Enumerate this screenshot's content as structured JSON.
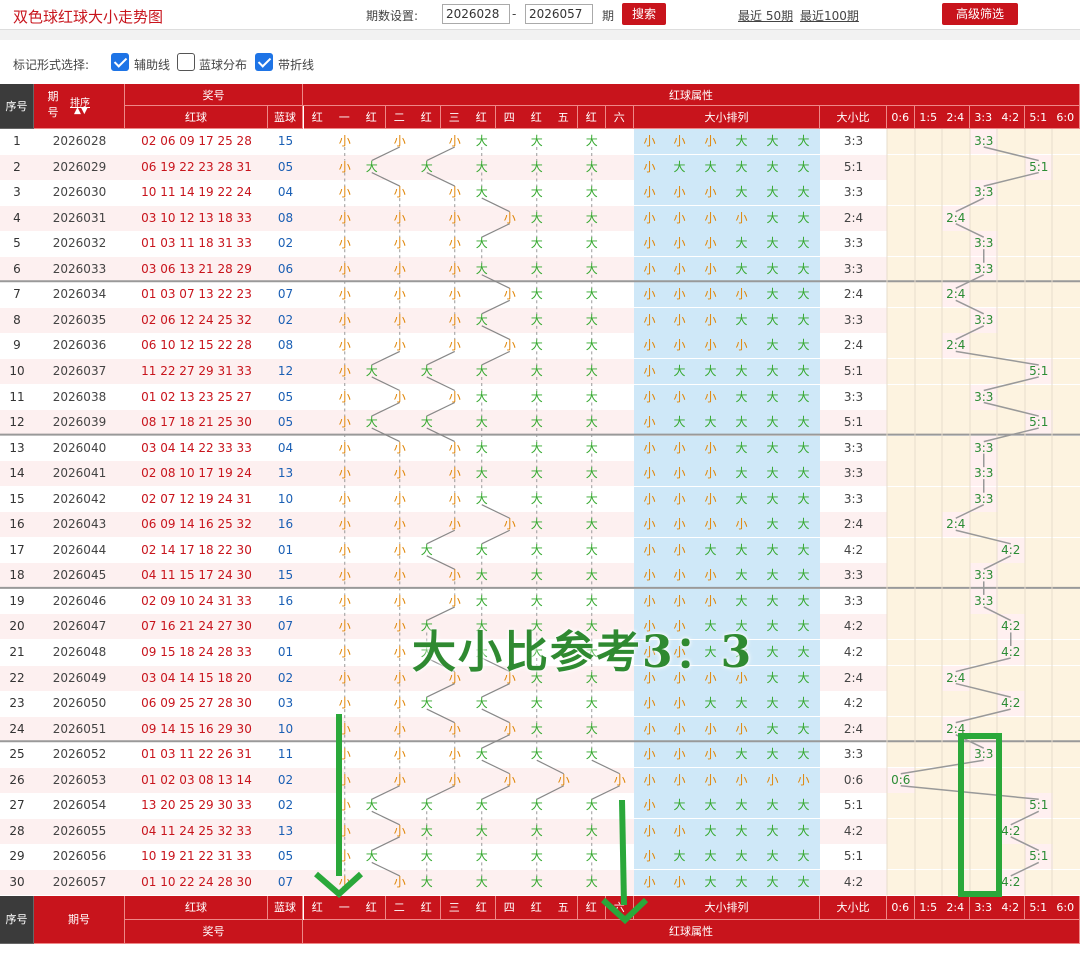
{
  "topbar": {
    "title": "双色球红球大小走势图",
    "period_label": "期数设置:",
    "from_value": "2026028",
    "dash": "-",
    "to_value": "2026057",
    "period_unit": "期",
    "search_label": "搜索",
    "recent50": "最近 50期",
    "recent100": "最近100期",
    "advanced_label": "高级筛选"
  },
  "options": {
    "label": "标记形式选择:",
    "aux_line": {
      "label": "辅助线",
      "checked": true
    },
    "blue_dist": {
      "label": "蓝球分布",
      "checked": false
    },
    "fold_line": {
      "label": "带折线",
      "checked": true
    }
  },
  "header": {
    "seq": "序号",
    "period": "期号",
    "sort": "排序",
    "prize": "奖号",
    "red_ball": "红球",
    "blue_ball": "蓝球",
    "red_attr": "红球属性",
    "size_arrange": "大小排列",
    "size_ratio": "大小比",
    "pos_labels": [
      "红",
      "一",
      "红",
      "二",
      "红",
      "三",
      "红",
      "四",
      "红",
      "五",
      "红",
      "六"
    ],
    "ratio_cols": [
      "0:6",
      "1:5",
      "2:4",
      "3:3",
      "4:2",
      "5:1",
      "6:0"
    ]
  },
  "rows": [
    {
      "seq": "1",
      "period": "2026028",
      "red": "02 06 09 17 25 28",
      "blue": "15",
      "sizes": [
        "小",
        "小",
        "小",
        "大",
        "大",
        "大"
      ],
      "ratio": "3:3"
    },
    {
      "seq": "2",
      "period": "2026029",
      "red": "06 19 22 23 28 31",
      "blue": "05",
      "sizes": [
        "小",
        "大",
        "大",
        "大",
        "大",
        "大"
      ],
      "ratio": "5:1"
    },
    {
      "seq": "3",
      "period": "2026030",
      "red": "10 11 14 19 22 24",
      "blue": "04",
      "sizes": [
        "小",
        "小",
        "小",
        "大",
        "大",
        "大"
      ],
      "ratio": "3:3"
    },
    {
      "seq": "4",
      "period": "2026031",
      "red": "03 10 12 13 18 33",
      "blue": "08",
      "sizes": [
        "小",
        "小",
        "小",
        "小",
        "大",
        "大"
      ],
      "ratio": "2:4"
    },
    {
      "seq": "5",
      "period": "2026032",
      "red": "01 03 11 18 31 33",
      "blue": "02",
      "sizes": [
        "小",
        "小",
        "小",
        "大",
        "大",
        "大"
      ],
      "ratio": "3:3"
    },
    {
      "seq": "6",
      "period": "2026033",
      "red": "03 06 13 21 28 29",
      "blue": "06",
      "sizes": [
        "小",
        "小",
        "小",
        "大",
        "大",
        "大"
      ],
      "ratio": "3:3"
    },
    {
      "seq": "7",
      "period": "2026034",
      "red": "01 03 07 13 22 23",
      "blue": "07",
      "sizes": [
        "小",
        "小",
        "小",
        "小",
        "大",
        "大"
      ],
      "ratio": "2:4"
    },
    {
      "seq": "8",
      "period": "2026035",
      "red": "02 06 12 24 25 32",
      "blue": "02",
      "sizes": [
        "小",
        "小",
        "小",
        "大",
        "大",
        "大"
      ],
      "ratio": "3:3"
    },
    {
      "seq": "9",
      "period": "2026036",
      "red": "06 10 12 15 22 28",
      "blue": "08",
      "sizes": [
        "小",
        "小",
        "小",
        "小",
        "大",
        "大"
      ],
      "ratio": "2:4"
    },
    {
      "seq": "10",
      "period": "2026037",
      "red": "11 22 27 29 31 33",
      "blue": "12",
      "sizes": [
        "小",
        "大",
        "大",
        "大",
        "大",
        "大"
      ],
      "ratio": "5:1"
    },
    {
      "seq": "11",
      "period": "2026038",
      "red": "01 02 13 23 25 27",
      "blue": "05",
      "sizes": [
        "小",
        "小",
        "小",
        "大",
        "大",
        "大"
      ],
      "ratio": "3:3"
    },
    {
      "seq": "12",
      "period": "2026039",
      "red": "08 17 18 21 25 30",
      "blue": "05",
      "sizes": [
        "小",
        "大",
        "大",
        "大",
        "大",
        "大"
      ],
      "ratio": "5:1"
    },
    {
      "seq": "13",
      "period": "2026040",
      "red": "03 04 14 22 33 33",
      "blue": "04",
      "sizes": [
        "小",
        "小",
        "小",
        "大",
        "大",
        "大"
      ],
      "ratio": "3:3"
    },
    {
      "seq": "14",
      "period": "2026041",
      "red": "02 08 10 17 19 24",
      "blue": "13",
      "sizes": [
        "小",
        "小",
        "小",
        "大",
        "大",
        "大"
      ],
      "ratio": "3:3"
    },
    {
      "seq": "15",
      "period": "2026042",
      "red": "02 07 12 19 24 31",
      "blue": "10",
      "sizes": [
        "小",
        "小",
        "小",
        "大",
        "大",
        "大"
      ],
      "ratio": "3:3"
    },
    {
      "seq": "16",
      "period": "2026043",
      "red": "06 09 14 16 25 32",
      "blue": "16",
      "sizes": [
        "小",
        "小",
        "小",
        "小",
        "大",
        "大"
      ],
      "ratio": "2:4"
    },
    {
      "seq": "17",
      "period": "2026044",
      "red": "02 14 17 18 22 30",
      "blue": "01",
      "sizes": [
        "小",
        "小",
        "大",
        "大",
        "大",
        "大"
      ],
      "ratio": "4:2"
    },
    {
      "seq": "18",
      "period": "2026045",
      "red": "04 11 15 17 24 30",
      "blue": "15",
      "sizes": [
        "小",
        "小",
        "小",
        "大",
        "大",
        "大"
      ],
      "ratio": "3:3"
    },
    {
      "seq": "19",
      "period": "2026046",
      "red": "02 09 10 24 31 33",
      "blue": "16",
      "sizes": [
        "小",
        "小",
        "小",
        "大",
        "大",
        "大"
      ],
      "ratio": "3:3"
    },
    {
      "seq": "20",
      "period": "2026047",
      "red": "07 16 21 24 27 30",
      "blue": "07",
      "sizes": [
        "小",
        "小",
        "大",
        "大",
        "大",
        "大"
      ],
      "ratio": "4:2"
    },
    {
      "seq": "21",
      "period": "2026048",
      "red": "09 15 18 24 28 33",
      "blue": "01",
      "sizes": [
        "小",
        "小",
        "大",
        "大",
        "大",
        "大"
      ],
      "ratio": "4:2"
    },
    {
      "seq": "22",
      "period": "2026049",
      "red": "03 04 14 15 18 20",
      "blue": "02",
      "sizes": [
        "小",
        "小",
        "小",
        "小",
        "大",
        "大"
      ],
      "ratio": "2:4"
    },
    {
      "seq": "23",
      "period": "2026050",
      "red": "06 09 25 27 28 30",
      "blue": "03",
      "sizes": [
        "小",
        "小",
        "大",
        "大",
        "大",
        "大"
      ],
      "ratio": "4:2"
    },
    {
      "seq": "24",
      "period": "2026051",
      "red": "09 14 15 16 29 30",
      "blue": "10",
      "sizes": [
        "小",
        "小",
        "小",
        "小",
        "大",
        "大"
      ],
      "ratio": "2:4"
    },
    {
      "seq": "25",
      "period": "2026052",
      "red": "01 03 11 22 26 31",
      "blue": "11",
      "sizes": [
        "小",
        "小",
        "小",
        "大",
        "大",
        "大"
      ],
      "ratio": "3:3"
    },
    {
      "seq": "26",
      "period": "2026053",
      "red": "01 02 03 08 13 14",
      "blue": "02",
      "sizes": [
        "小",
        "小",
        "小",
        "小",
        "小",
        "小"
      ],
      "ratio": "0:6"
    },
    {
      "seq": "27",
      "period": "2026054",
      "red": "13 20 25 29 30 33",
      "blue": "02",
      "sizes": [
        "小",
        "大",
        "大",
        "大",
        "大",
        "大"
      ],
      "ratio": "5:1"
    },
    {
      "seq": "28",
      "period": "2026055",
      "red": "04 11 24 25 32 33",
      "blue": "13",
      "sizes": [
        "小",
        "小",
        "大",
        "大",
        "大",
        "大"
      ],
      "ratio": "4:2"
    },
    {
      "seq": "29",
      "period": "2026056",
      "red": "10 19 21 22 31 33",
      "blue": "05",
      "sizes": [
        "小",
        "大",
        "大",
        "大",
        "大",
        "大"
      ],
      "ratio": "5:1"
    },
    {
      "seq": "30",
      "period": "2026057",
      "red": "01 10 22 24 28 30",
      "blue": "07",
      "sizes": [
        "小",
        "小",
        "大",
        "大",
        "大",
        "大"
      ],
      "ratio": "4:2"
    }
  ],
  "footer": {
    "seq": "序号",
    "period": "期号",
    "red_ball": "红球",
    "blue_ball": "蓝球",
    "prize": "奖号",
    "red_attr": "红球属性",
    "size_arrange": "大小排列",
    "size_ratio": "大小比"
  },
  "annotation": {
    "text": "大小比参考3：3",
    "color": "#2f8a31"
  },
  "colors": {
    "header_red": "#c8141c",
    "header_gray": "#3b3b3b",
    "row_odd": "#ffffff",
    "row_even": "#fdf0f0",
    "size_zone_bg": "#cfe8f8",
    "ratio_zone_bg": "#fdf3e0",
    "xiao": "#e0870a",
    "da": "#35a82f"
  }
}
